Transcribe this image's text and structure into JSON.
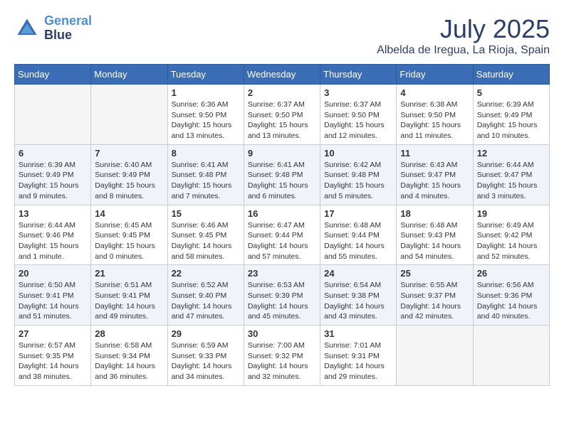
{
  "header": {
    "logo_line1": "General",
    "logo_line2": "Blue",
    "month": "July 2025",
    "location": "Albelda de Iregua, La Rioja, Spain"
  },
  "weekdays": [
    "Sunday",
    "Monday",
    "Tuesday",
    "Wednesday",
    "Thursday",
    "Friday",
    "Saturday"
  ],
  "weeks": [
    [
      {
        "day": "",
        "info": ""
      },
      {
        "day": "",
        "info": ""
      },
      {
        "day": "1",
        "info": "Sunrise: 6:36 AM\nSunset: 9:50 PM\nDaylight: 15 hours and 13 minutes."
      },
      {
        "day": "2",
        "info": "Sunrise: 6:37 AM\nSunset: 9:50 PM\nDaylight: 15 hours and 13 minutes."
      },
      {
        "day": "3",
        "info": "Sunrise: 6:37 AM\nSunset: 9:50 PM\nDaylight: 15 hours and 12 minutes."
      },
      {
        "day": "4",
        "info": "Sunrise: 6:38 AM\nSunset: 9:50 PM\nDaylight: 15 hours and 11 minutes."
      },
      {
        "day": "5",
        "info": "Sunrise: 6:39 AM\nSunset: 9:49 PM\nDaylight: 15 hours and 10 minutes."
      }
    ],
    [
      {
        "day": "6",
        "info": "Sunrise: 6:39 AM\nSunset: 9:49 PM\nDaylight: 15 hours and 9 minutes."
      },
      {
        "day": "7",
        "info": "Sunrise: 6:40 AM\nSunset: 9:49 PM\nDaylight: 15 hours and 8 minutes."
      },
      {
        "day": "8",
        "info": "Sunrise: 6:41 AM\nSunset: 9:48 PM\nDaylight: 15 hours and 7 minutes."
      },
      {
        "day": "9",
        "info": "Sunrise: 6:41 AM\nSunset: 9:48 PM\nDaylight: 15 hours and 6 minutes."
      },
      {
        "day": "10",
        "info": "Sunrise: 6:42 AM\nSunset: 9:48 PM\nDaylight: 15 hours and 5 minutes."
      },
      {
        "day": "11",
        "info": "Sunrise: 6:43 AM\nSunset: 9:47 PM\nDaylight: 15 hours and 4 minutes."
      },
      {
        "day": "12",
        "info": "Sunrise: 6:44 AM\nSunset: 9:47 PM\nDaylight: 15 hours and 3 minutes."
      }
    ],
    [
      {
        "day": "13",
        "info": "Sunrise: 6:44 AM\nSunset: 9:46 PM\nDaylight: 15 hours and 1 minute."
      },
      {
        "day": "14",
        "info": "Sunrise: 6:45 AM\nSunset: 9:45 PM\nDaylight: 15 hours and 0 minutes."
      },
      {
        "day": "15",
        "info": "Sunrise: 6:46 AM\nSunset: 9:45 PM\nDaylight: 14 hours and 58 minutes."
      },
      {
        "day": "16",
        "info": "Sunrise: 6:47 AM\nSunset: 9:44 PM\nDaylight: 14 hours and 57 minutes."
      },
      {
        "day": "17",
        "info": "Sunrise: 6:48 AM\nSunset: 9:44 PM\nDaylight: 14 hours and 55 minutes."
      },
      {
        "day": "18",
        "info": "Sunrise: 6:48 AM\nSunset: 9:43 PM\nDaylight: 14 hours and 54 minutes."
      },
      {
        "day": "19",
        "info": "Sunrise: 6:49 AM\nSunset: 9:42 PM\nDaylight: 14 hours and 52 minutes."
      }
    ],
    [
      {
        "day": "20",
        "info": "Sunrise: 6:50 AM\nSunset: 9:41 PM\nDaylight: 14 hours and 51 minutes."
      },
      {
        "day": "21",
        "info": "Sunrise: 6:51 AM\nSunset: 9:41 PM\nDaylight: 14 hours and 49 minutes."
      },
      {
        "day": "22",
        "info": "Sunrise: 6:52 AM\nSunset: 9:40 PM\nDaylight: 14 hours and 47 minutes."
      },
      {
        "day": "23",
        "info": "Sunrise: 6:53 AM\nSunset: 9:39 PM\nDaylight: 14 hours and 45 minutes."
      },
      {
        "day": "24",
        "info": "Sunrise: 6:54 AM\nSunset: 9:38 PM\nDaylight: 14 hours and 43 minutes."
      },
      {
        "day": "25",
        "info": "Sunrise: 6:55 AM\nSunset: 9:37 PM\nDaylight: 14 hours and 42 minutes."
      },
      {
        "day": "26",
        "info": "Sunrise: 6:56 AM\nSunset: 9:36 PM\nDaylight: 14 hours and 40 minutes."
      }
    ],
    [
      {
        "day": "27",
        "info": "Sunrise: 6:57 AM\nSunset: 9:35 PM\nDaylight: 14 hours and 38 minutes."
      },
      {
        "day": "28",
        "info": "Sunrise: 6:58 AM\nSunset: 9:34 PM\nDaylight: 14 hours and 36 minutes."
      },
      {
        "day": "29",
        "info": "Sunrise: 6:59 AM\nSunset: 9:33 PM\nDaylight: 14 hours and 34 minutes."
      },
      {
        "day": "30",
        "info": "Sunrise: 7:00 AM\nSunset: 9:32 PM\nDaylight: 14 hours and 32 minutes."
      },
      {
        "day": "31",
        "info": "Sunrise: 7:01 AM\nSunset: 9:31 PM\nDaylight: 14 hours and 29 minutes."
      },
      {
        "day": "",
        "info": ""
      },
      {
        "day": "",
        "info": ""
      }
    ]
  ]
}
